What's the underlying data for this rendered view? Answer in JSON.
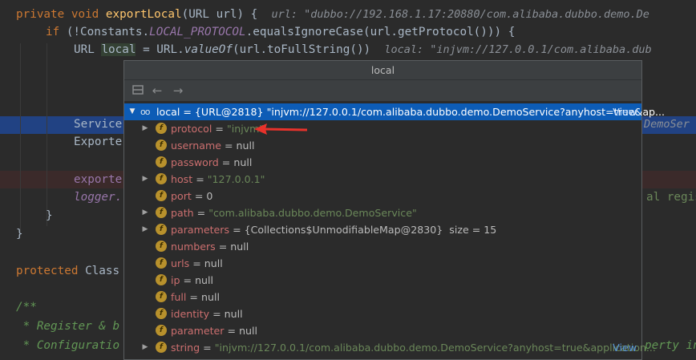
{
  "editor": {
    "line1": {
      "kw": "private void ",
      "fn": "exportLocal",
      "rest": "(URL url) {",
      "hint": "url: \"dubbo://192.168.1.17:20880/com.alibaba.dubbo.demo.De"
    },
    "line2": {
      "kw": "if ",
      "pre": "(!Constants.",
      "const": "LOCAL_PROTOCOL",
      "post": ".equalsIgnoreCase(url.getProtocol())) {"
    },
    "line3": {
      "pre": "URL ",
      "var": "local",
      "mid": " = URL.",
      "call": "valueOf",
      "post": "(url.toFullString())",
      "hint": "local: \"injvm://127.0.0.1/com.alibaba.dub"
    },
    "line4_left": "Service",
    "line4_right": "DemoSer",
    "line5_left": "Exporte",
    "line6_left": "exporte",
    "line7_left": "logger.",
    "line7_right": "al regis",
    "line8": "}",
    "line9": "}",
    "line10_kw": "protected ",
    "line10_rest": "Class",
    "line11": "/**",
    "line12_left": " * Register & b",
    "line13_left": " * Configuratio",
    "line13_right": "perty in"
  },
  "popup": {
    "title": "local",
    "toolbar_icons": [
      "db-icon",
      "back-arrow-icon",
      "forward-arrow-icon"
    ],
    "root": {
      "name": "local",
      "value_prefix": " = {URL@2818} ",
      "value": "\"injvm://127.0.0.1/com.alibaba.dubbo.demo.DemoService?anyhost=true&ap...",
      "view": "View"
    },
    "fields": [
      {
        "name": "protocol",
        "eq": " = ",
        "value": "\"injvm\"",
        "kind": "str",
        "expandable": true
      },
      {
        "name": "username",
        "eq": " = ",
        "value": "null",
        "kind": "plain",
        "expandable": false
      },
      {
        "name": "password",
        "eq": " = ",
        "value": "null",
        "kind": "plain",
        "expandable": false
      },
      {
        "name": "host",
        "eq": " = ",
        "value": "\"127.0.0.1\"",
        "kind": "str",
        "expandable": true
      },
      {
        "name": "port",
        "eq": " = ",
        "value": "0",
        "kind": "plain",
        "expandable": false
      },
      {
        "name": "path",
        "eq": " = ",
        "value": "\"com.alibaba.dubbo.demo.DemoService\"",
        "kind": "str",
        "expandable": true
      },
      {
        "name": "parameters",
        "eq": " = ",
        "value": "{Collections$UnmodifiableMap@2830}  size = 15",
        "kind": "plain",
        "expandable": true
      },
      {
        "name": "numbers",
        "eq": " = ",
        "value": "null",
        "kind": "plain",
        "expandable": false
      },
      {
        "name": "urls",
        "eq": " = ",
        "value": "null",
        "kind": "plain",
        "expandable": false
      },
      {
        "name": "ip",
        "eq": " = ",
        "value": "null",
        "kind": "plain",
        "expandable": false
      },
      {
        "name": "full",
        "eq": " = ",
        "value": "null",
        "kind": "plain",
        "expandable": false
      },
      {
        "name": "identity",
        "eq": " = ",
        "value": "null",
        "kind": "plain",
        "expandable": false
      },
      {
        "name": "parameter",
        "eq": " = ",
        "value": "null",
        "kind": "plain",
        "expandable": false
      },
      {
        "name": "string",
        "eq": " = ",
        "value": "\"injvm://127.0.0.1/com.alibaba.dubbo.demo.DemoService?anyhost=true&application...",
        "kind": "str",
        "expandable": true,
        "view": "View"
      }
    ],
    "field_icon_letter": "f",
    "annotation_color": "#e8322b"
  }
}
